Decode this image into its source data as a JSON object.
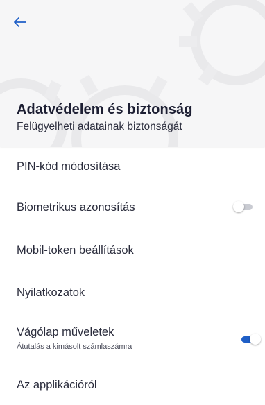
{
  "header": {
    "back_icon": "arrow-left-icon",
    "title": "Adatvédelem és biztonság",
    "subtitle": "Felügyelheti adatainak biztonságát",
    "background_color": "#f6f6f7",
    "accent_color": "#1f5fc7"
  },
  "menu": {
    "items": [
      {
        "label": "PIN-kód módosítása"
      },
      {
        "label": "Biometrikus azonosítás",
        "toggle": "off"
      },
      {
        "label": "Mobil-token beállítások"
      },
      {
        "label": "Nyilatkozatok"
      },
      {
        "label": "Vágólap műveletek",
        "sublabel": "Átutalás a kimásolt számlaszámra",
        "toggle": "on"
      },
      {
        "label": "Az applikációról"
      }
    ]
  }
}
